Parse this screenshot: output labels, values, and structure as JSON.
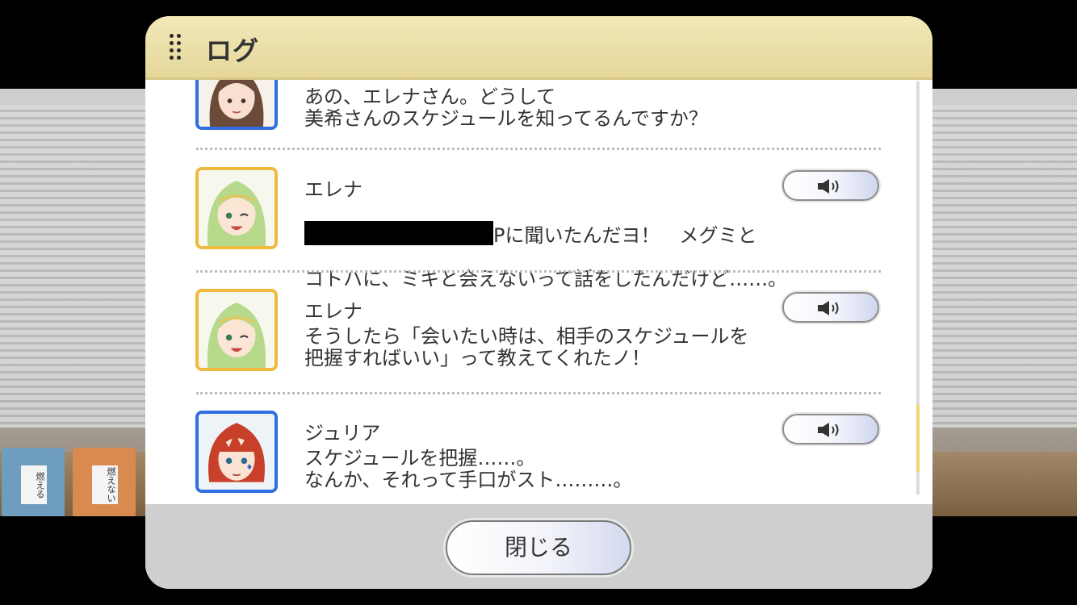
{
  "dialog": {
    "title": "ログ",
    "close_label": "閉じる"
  },
  "log": [
    {
      "speaker": "",
      "lines": "あの、エレナさん。どうして\n美希さんのスケジュールを知ってるんですか？",
      "avatar": "brown-hair-girl",
      "frame_color": "#2f6fe0",
      "has_voice": false
    },
    {
      "speaker": "エレナ",
      "line1_suffix": "Pに聞いたんだヨ！　メグミと",
      "line2": "コトハに、ミキと会えないって話をしたんだけど……。",
      "avatar": "green-hair-girl",
      "frame_color": "#f0b940",
      "has_voice": true
    },
    {
      "speaker": "エレナ",
      "lines": "そうしたら「会いたい時は、相手のスケジュールを\n把握すればいい」って教えてくれたノ！",
      "avatar": "green-hair-girl",
      "frame_color": "#f0b940",
      "has_voice": true
    },
    {
      "speaker": "ジュリア",
      "lines": "スケジュールを把握……。\nなんか、それって手口がスト………。",
      "avatar": "red-hair-girl",
      "frame_color": "#2f6fe0",
      "has_voice": true
    }
  ],
  "background": {
    "bin_blue_label": "燃える",
    "bin_orange_label": "燃えない"
  },
  "icons": {
    "voice": "speaker-icon",
    "grip": "grip-icon"
  }
}
